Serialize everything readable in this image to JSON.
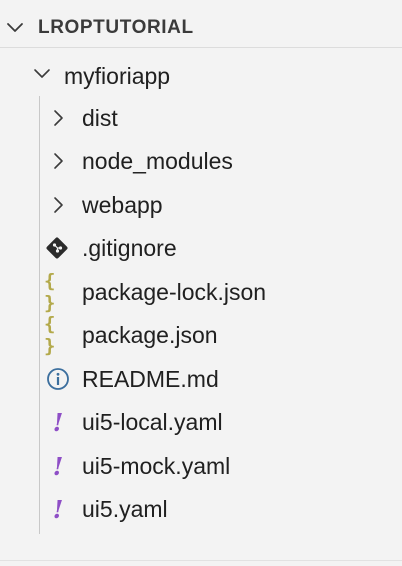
{
  "explorer": {
    "section_title": "LROPTUTORIAL",
    "root_folder": {
      "label": "myfioriapp",
      "expanded": true
    },
    "folders": [
      {
        "label": "dist",
        "expanded": false
      },
      {
        "label": "node_modules",
        "expanded": false
      },
      {
        "label": "webapp",
        "expanded": false
      }
    ],
    "files": [
      {
        "label": ".gitignore",
        "icon": "git-icon"
      },
      {
        "label": "package-lock.json",
        "icon": "json-braces-icon"
      },
      {
        "label": "package.json",
        "icon": "json-braces-icon"
      },
      {
        "label": "README.md",
        "icon": "info-icon"
      },
      {
        "label": "ui5-local.yaml",
        "icon": "yaml-exclamation-icon"
      },
      {
        "label": "ui5-mock.yaml",
        "icon": "yaml-exclamation-icon"
      },
      {
        "label": "ui5.yaml",
        "icon": "yaml-exclamation-icon"
      }
    ],
    "icon_glyphs": {
      "json_braces": "{ }",
      "yaml_bang": "!"
    },
    "colors": {
      "background": "#f3f3f3",
      "json_icon": "#b3a94a",
      "yaml_icon": "#8e4ec6",
      "info_icon": "#3c6f9e",
      "git_icon": "#2b2b2b"
    }
  }
}
